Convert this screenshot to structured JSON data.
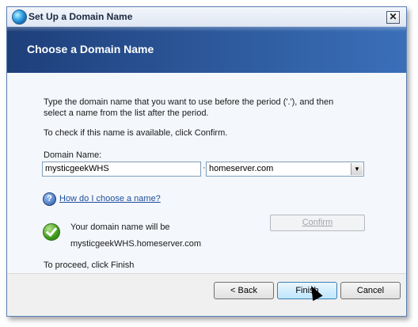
{
  "window": {
    "title": "Set Up a Domain Name",
    "close_glyph": "✕"
  },
  "header": {
    "title": "Choose a Domain Name"
  },
  "content": {
    "intro_line1": "Type the domain name that you want to use before the period ('.'), and then",
    "intro_line2": "select a name from the list after the period.",
    "check_text": "To check if this name is available, click Confirm.",
    "domain_label": "Domain Name:",
    "domain_value": "mysticgeekWHS",
    "separator": "·",
    "suffix_value": "homeserver.com",
    "help_glyph": "?",
    "help_link": "How do I choose a name?",
    "status_line1": "Your domain name will be",
    "status_line2": "mysticgeekWHS.homeserver.com",
    "confirm_label": "Confirm",
    "proceed_text": "To proceed, click Finish"
  },
  "footer": {
    "back_label": "< Back",
    "finish_label": "Finish",
    "cancel_label": "Cancel"
  },
  "colors": {
    "banner": "#2b5597",
    "link": "#1f4e9c",
    "accent": "#3c7fb1"
  }
}
